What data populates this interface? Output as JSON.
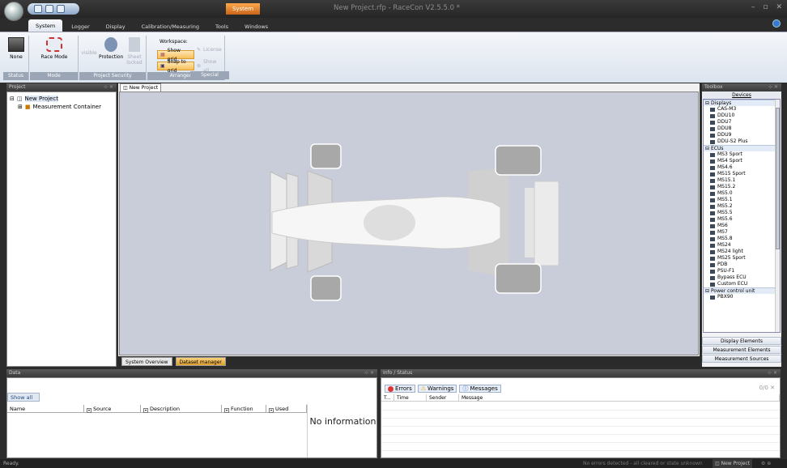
{
  "window": {
    "title": "New Project.rfp - RaceCon V2.5.5.0 *",
    "context_tab": "System"
  },
  "ribbon_tabs": [
    "System",
    "Logger",
    "Display",
    "Calibration/Measuring",
    "Tools",
    "Windows"
  ],
  "ribbon": {
    "status": {
      "label": "Status",
      "none": "None"
    },
    "mode": {
      "label": "Mode",
      "race_mode": "Race Mode"
    },
    "security": {
      "label": "Project Security",
      "visible": "visible",
      "protection": "Protection",
      "sheet": "Sheet locked"
    },
    "arrangement": {
      "label": "Arrangement",
      "workspace": "Workspace:",
      "show_grid": "Show grid",
      "snap": "Snap to grid",
      "license": "License",
      "show_all": "Show all"
    },
    "special": {
      "label": "Special"
    }
  },
  "project_panel": {
    "title": "Project",
    "root": "New Project",
    "child": "Measurement Container"
  },
  "document": {
    "tab": "New Project",
    "bottom_tabs": [
      "System Overview",
      "Dataset manager"
    ]
  },
  "toolbox": {
    "title": "Toolbox",
    "devices": "Devices",
    "categories": [
      {
        "name": "Displays",
        "items": [
          "CAS-M3",
          "DDU10",
          "DDU7",
          "DDU8",
          "DDU9",
          "DDU-S2 Plus"
        ]
      },
      {
        "name": "ECUs",
        "items": [
          "MS3 Sport",
          "MS4 Sport",
          "MS4.6",
          "MS15 Sport",
          "MS15.1",
          "MS15.2",
          "MS5.0",
          "MS5.1",
          "MS5.2",
          "MS5.5",
          "MS5.6",
          "MS6",
          "MS7",
          "MS5.8",
          "MS24",
          "MS24 light",
          "MS25 Sport",
          "PDB",
          "PSU-F1",
          "Bypass ECU",
          "Custom ECU"
        ]
      },
      {
        "name": "Power control unit",
        "items": [
          "PBX90"
        ]
      }
    ],
    "footer": [
      "Display Elements",
      "Measurement Elements",
      "Measurement Sources"
    ]
  },
  "data_panel": {
    "title": "Data",
    "show_all": "Show all",
    "columns": [
      "Name",
      "Source",
      "Description",
      "Function",
      "Used"
    ],
    "no_info": "No information"
  },
  "info_panel": {
    "title": "Info / Status",
    "tabs": [
      "Errors",
      "Warnings",
      "Messages"
    ],
    "counter": "0/0",
    "columns": [
      "T...",
      "Time",
      "Sender",
      "Message"
    ]
  },
  "status": {
    "left": "Ready.",
    "right": "No errors detected - all cleared or state unknown",
    "project": "New Project"
  }
}
